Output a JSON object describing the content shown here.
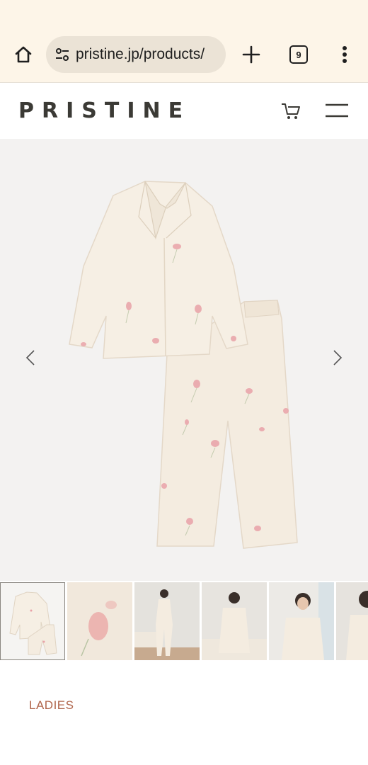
{
  "browser": {
    "url": "pristine.jp/products/",
    "tab_count": "9"
  },
  "site": {
    "logo": "PRISTINE"
  },
  "product": {
    "category": "LADIES",
    "image_description": "cream pajama set with pink tulip print",
    "thumbnail_count": 6
  },
  "colors": {
    "browser_bg": "#fdf5e8",
    "url_pill": "#ebe3d6",
    "gallery_bg": "#f3f2f1",
    "fabric": "#f4ece0",
    "print_pink": "#e9a2a8",
    "accent": "#b0654b",
    "logo": "#3b3a35"
  }
}
